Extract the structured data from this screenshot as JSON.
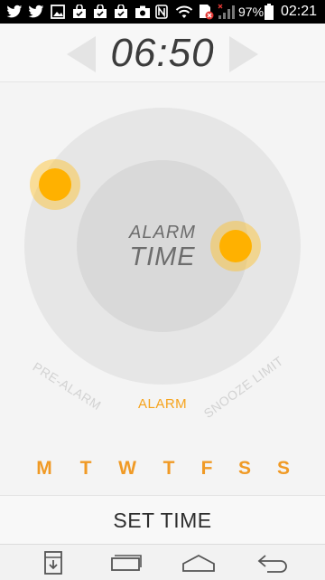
{
  "status_bar": {
    "battery_percent": "97%",
    "clock": "02:21",
    "icons": [
      "twitter-icon",
      "twitter-icon",
      "image-icon",
      "shopping-bag-icon",
      "shopping-bag-icon",
      "shopping-bag-icon",
      "camera-icon",
      "nfc-icon",
      "wifi-icon",
      "sim-error-icon",
      "signal-icon",
      "battery-icon"
    ]
  },
  "header": {
    "alarm_time": "06:50",
    "prev_icon": "chevron-left-icon",
    "next_icon": "chevron-right-icon"
  },
  "dial": {
    "center_line1": "ALARM",
    "center_line2": "TIME",
    "labels": {
      "pre_alarm": "PRE-ALARM",
      "alarm": "ALARM",
      "snooze_limit": "SNOOZE LIMIT"
    },
    "accent_color": "#ffb100"
  },
  "days": [
    "M",
    "T",
    "W",
    "T",
    "F",
    "S",
    "S"
  ],
  "set_time_label": "SET TIME",
  "nav": {
    "icons": [
      "download-icon",
      "recent-apps-icon",
      "home-icon",
      "back-icon"
    ]
  }
}
